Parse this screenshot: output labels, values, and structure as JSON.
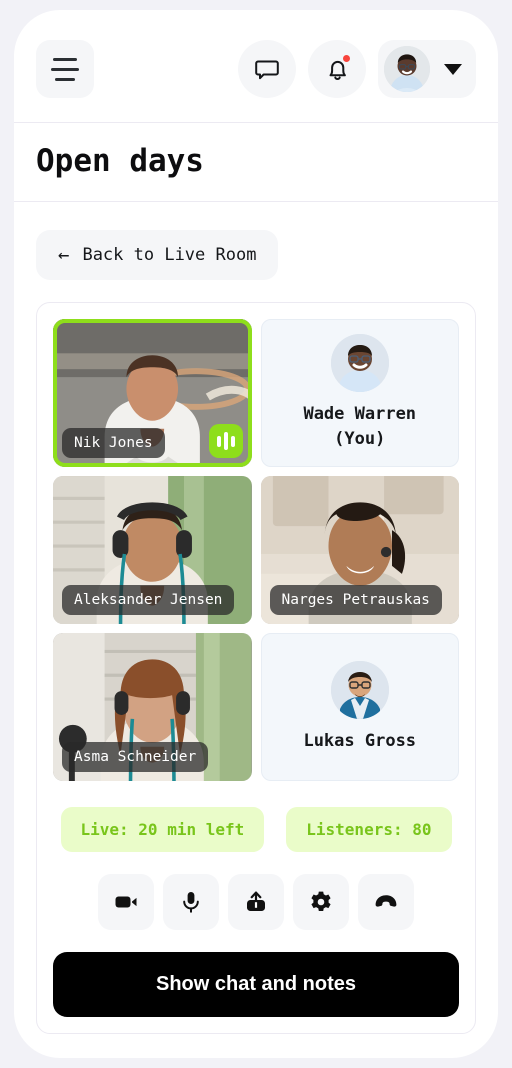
{
  "header": {
    "menu_icon": "hamburger-menu-icon",
    "chat_icon": "chat-bubble-icon",
    "notifications_icon": "bell-icon",
    "has_notification": true,
    "avatar_icon": "user-avatar",
    "dropdown_icon": "chevron-down-icon"
  },
  "page_title": "Open days",
  "back_button": {
    "label": "Back to Live Room",
    "arrow": "←"
  },
  "participants": [
    {
      "name": "Nik Jones",
      "type": "video",
      "active_speaker": true,
      "speaking_icon": "audio-wave-icon"
    },
    {
      "name": "Wade Warren\n(You)",
      "name_line1": "Wade Warren",
      "name_line2": "(You)",
      "type": "placeholder",
      "active_speaker": false
    },
    {
      "name": "Aleksander Jensen",
      "type": "video",
      "active_speaker": false
    },
    {
      "name": "Narges Petrauskas",
      "type": "video",
      "active_speaker": false
    },
    {
      "name": "Asma Schneider",
      "type": "video",
      "active_speaker": false
    },
    {
      "name": "Lukas Gross",
      "name_line1": "Lukas Gross",
      "name_line2": "",
      "type": "placeholder",
      "active_speaker": false
    }
  ],
  "status": {
    "live": "Live: 20 min left",
    "listeners": "Listeners: 80"
  },
  "controls": [
    {
      "name": "camera",
      "icon": "video-camera-icon"
    },
    {
      "name": "microphone",
      "icon": "microphone-icon"
    },
    {
      "name": "share",
      "icon": "share-upload-icon"
    },
    {
      "name": "settings",
      "icon": "gear-icon"
    },
    {
      "name": "end-call",
      "icon": "phone-hangup-icon"
    }
  ],
  "chat_button": {
    "label": "Show chat and notes"
  },
  "colors": {
    "accent_green": "#8ede1b",
    "pill_bg": "#eafcc9",
    "pill_text": "#79c51b",
    "notification_dot": "#f8443c",
    "button_black": "#000000",
    "surface": "#f5f6f8"
  }
}
